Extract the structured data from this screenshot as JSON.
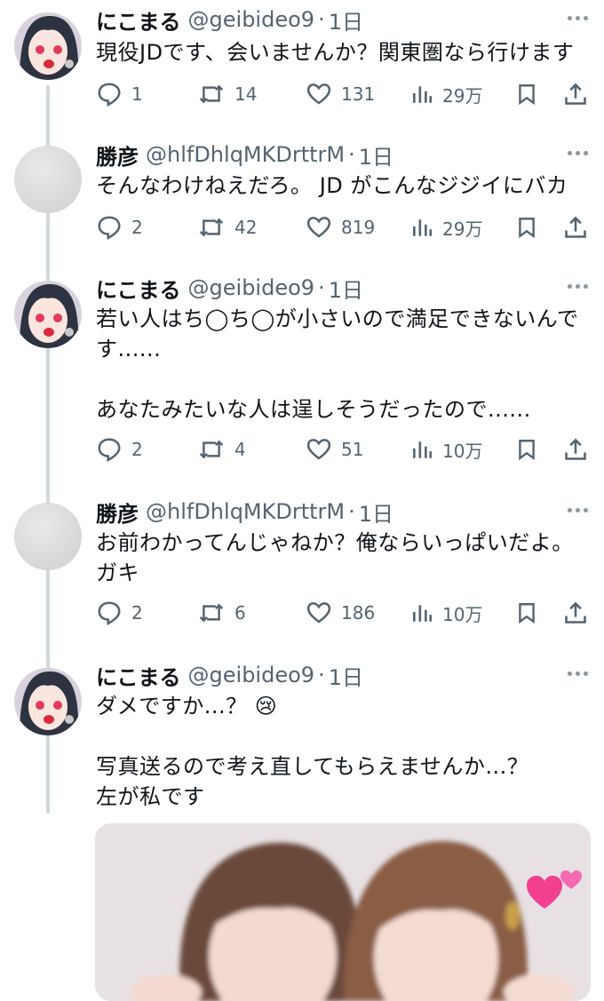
{
  "tweets": [
    {
      "name": "にこまる",
      "handle": "@geibideo9",
      "time": "1日",
      "text": "現役JDです、会いませんか？関東圏なら行けます",
      "avatar": "anime-girl",
      "replies": "1",
      "retweets": "14",
      "likes": "131",
      "views": "29万"
    },
    {
      "name": "勝彦",
      "handle": "@hlfDhlqMKDrttrM",
      "time": "1日",
      "text": "そんなわけねえだろ。 JD がこんなジジイにバカ",
      "avatar": "gray",
      "replies": "2",
      "retweets": "42",
      "likes": "819",
      "views": "29万"
    },
    {
      "name": "にこまる",
      "handle": "@geibideo9",
      "time": "1日",
      "text": "若い人はち◯ち◯が小さいので満足できないんです......\n\nあなたみたいな人は逞しそうだったので......",
      "avatar": "anime-girl",
      "replies": "2",
      "retweets": "4",
      "likes": "51",
      "views": "10万"
    },
    {
      "name": "勝彦",
      "handle": "@hlfDhlqMKDrttrM",
      "time": "1日",
      "text": "お前わかってんじゃねか？俺ならいっぱいだよ。ガキ",
      "avatar": "gray",
      "replies": "2",
      "retweets": "6",
      "likes": "186",
      "views": "10万"
    },
    {
      "name": "にこまる",
      "handle": "@geibideo9",
      "time": "1日",
      "text": "ダメですか...？ 😢\n\n写真送るので考え直してもらえませんか...？\n左が私です",
      "avatar": "anime-girl",
      "has_photo": true
    }
  ],
  "icons": {
    "reply": "reply-icon",
    "retweet": "retweet-icon",
    "like": "like-icon",
    "views": "views-icon",
    "bookmark": "bookmark-icon",
    "share": "share-icon",
    "more": "more-icon",
    "photo_sticker": "hearts-sticker"
  },
  "colors": {
    "text": "#0f1419",
    "secondary": "#536471",
    "thread_line": "#cfd9de"
  }
}
